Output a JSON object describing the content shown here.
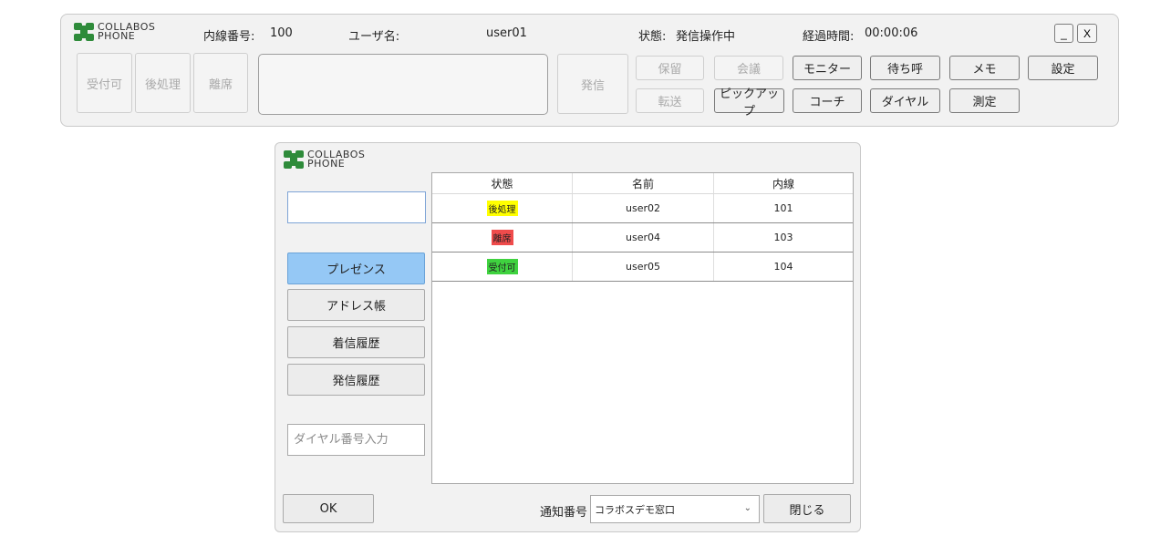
{
  "brand": {
    "line1": "COLLABOS",
    "line2": "PHONE",
    "logo_icon": "collabos-logo-icon"
  },
  "toolbar": {
    "extension_label": "内線番号:",
    "extension_value": "100",
    "username_label": "ユーザ名:",
    "username_value": "user01",
    "state_label": "状態:",
    "state_value": "発信操作中",
    "elapsed_label": "経過時間:",
    "elapsed_value": "00:00:06",
    "minimize_label": "_",
    "close_label": "X",
    "status_buttons": {
      "available": "受付可",
      "after_work": "後処理",
      "away": "離席"
    },
    "call_button": "発信",
    "hold_button": "保留",
    "conference_button": "会議",
    "transfer_button": "転送",
    "pickup_button": "ピックアップ",
    "monitor_button": "モニター",
    "coach_button": "コーチ",
    "queue_button": "待ち呼",
    "dial_button": "ダイヤル",
    "memo_button": "メモ",
    "measure_button": "測定",
    "settings_button": "設定"
  },
  "dialog": {
    "search_value": "",
    "nav": {
      "presence": "プレゼンス",
      "address_book": "アドレス帳",
      "incoming_history": "着信履歴",
      "outgoing_history": "発信履歴"
    },
    "dial_placeholder": "ダイヤル番号入力",
    "table": {
      "headers": {
        "state": "状態",
        "name": "名前",
        "extension": "内線"
      },
      "rows": [
        {
          "state": "後処理",
          "state_color": "#ffff00",
          "name": "user02",
          "extension": "101"
        },
        {
          "state": "離席",
          "state_color": "#ef4b4b",
          "name": "user04",
          "extension": "103"
        },
        {
          "state": "受付可",
          "state_color": "#3fd23f",
          "name": "user05",
          "extension": "104"
        }
      ]
    },
    "ok_button": "OK",
    "notify_label": "通知番号",
    "notify_value": "コラボスデモ窓口",
    "close_button": "閉じる"
  }
}
